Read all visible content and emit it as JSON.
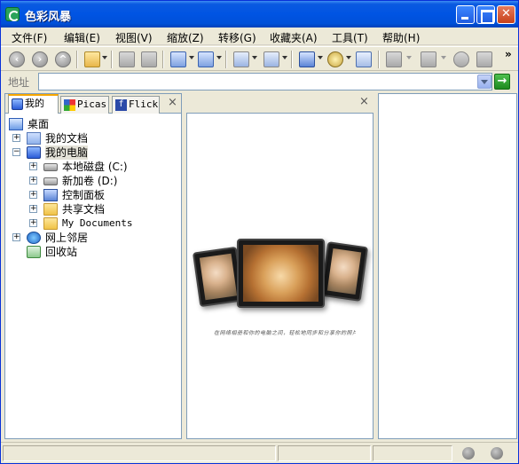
{
  "window": {
    "title": "色彩风暴"
  },
  "menu": [
    "文件(F)",
    "编辑(E)",
    "视图(V)",
    "缩放(Z)",
    "转移(G)",
    "收藏夹(A)",
    "工具(T)",
    "帮助(H)"
  ],
  "toolbar": {
    "more": "»"
  },
  "address": {
    "label": "地址",
    "value": ""
  },
  "tabs": [
    "我的",
    "Picas",
    "Flick"
  ],
  "pane_close": "×",
  "tree": [
    {
      "label": "桌面"
    },
    {
      "label": "我的文档"
    },
    {
      "label": "我的电脑"
    },
    {
      "label": "本地磁盘 (C:)"
    },
    {
      "label": "新加卷 (D:)"
    },
    {
      "label": "控制面板"
    },
    {
      "label": "共享文档"
    },
    {
      "label": "My Documents"
    },
    {
      "label": "网上邻居"
    },
    {
      "label": "回收站"
    }
  ],
  "preview": {
    "caption": "在网络相册和你的电脑之间，轻松地同步和分享你的照片"
  }
}
